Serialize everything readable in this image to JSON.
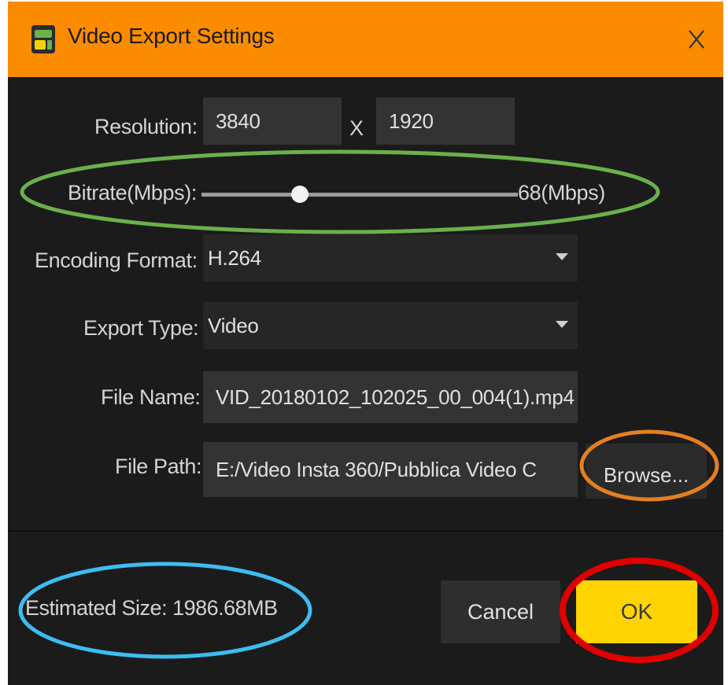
{
  "window": {
    "title": "Video Export Settings",
    "close_glyph": "X",
    "titlebar_color": "#fb8c00",
    "background_color": "#1b1b1b"
  },
  "form": {
    "resolution_label": "Resolution:",
    "resolution_width": "3840",
    "resolution_separator": "X",
    "resolution_height": "1920",
    "bitrate_label": "Bitrate(Mbps):",
    "bitrate_value": "68(Mbps)",
    "bitrate_slider_fraction": 0.31,
    "encoding_label": "Encoding Format:",
    "encoding_value": "H.264",
    "export_type_label": "Export Type:",
    "export_type_value": "Video",
    "file_name_label": "File Name:",
    "file_name_value": "VID_20180102_102025_00_004(1).mp4",
    "file_path_label": "File Path:",
    "file_path_value": "E:/Video Insta 360/Pubblica Video C",
    "browse_label": "Browse..."
  },
  "footer": {
    "estimated_size": "Estimated Size:  1986.68MB",
    "cancel_label": "Cancel",
    "ok_label": "OK",
    "ok_color": "#ffd400"
  },
  "annotations": {
    "bitrate_circle_color": "#6ab04c",
    "browse_circle_color": "#e67e22",
    "size_circle_color": "#3dbdf0",
    "ok_circle_color": "#e00000"
  },
  "icons": {
    "app": "app-logo-icon",
    "close": "close-icon",
    "dropdown": "chevron-down-icon",
    "slider": "slider-knob-icon"
  }
}
